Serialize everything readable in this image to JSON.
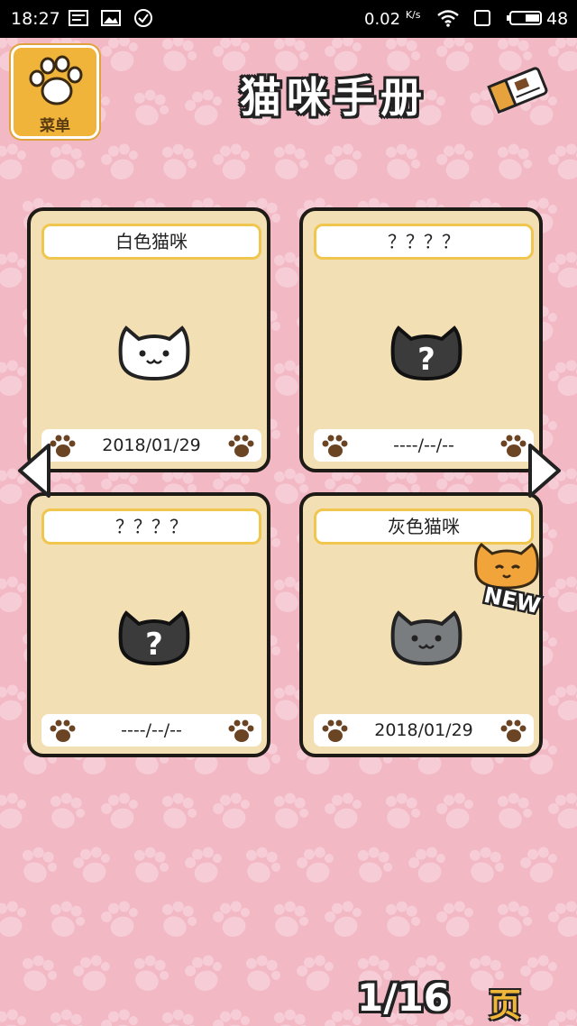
{
  "status_bar": {
    "time": "18:27",
    "net_speed": "0.02",
    "net_unit": "K/s",
    "battery": "48"
  },
  "menu": {
    "label": "菜单"
  },
  "title": "猫咪手册",
  "cards": [
    {
      "name": "白色猫咪",
      "date": "2018/01/29",
      "cat": "white-cat-icon",
      "discovered": true,
      "is_new": false
    },
    {
      "name": "？？？？",
      "date": "----/--/--",
      "cat": "unknown-cat-icon",
      "discovered": false,
      "is_new": false
    },
    {
      "name": "？？？？",
      "date": "----/--/--",
      "cat": "unknown-cat-icon",
      "discovered": false,
      "is_new": false
    },
    {
      "name": "灰色猫咪",
      "date": "2018/01/29",
      "cat": "gray-cat-icon",
      "discovered": true,
      "is_new": true
    }
  ],
  "new_badge": "NEW",
  "pager": {
    "current": "1",
    "total": "16",
    "suffix": "页"
  },
  "colors": {
    "background": "#f2b8c4",
    "card": "#f3dfb4",
    "menu": "#f1b43a",
    "paw": "#6b4424"
  }
}
